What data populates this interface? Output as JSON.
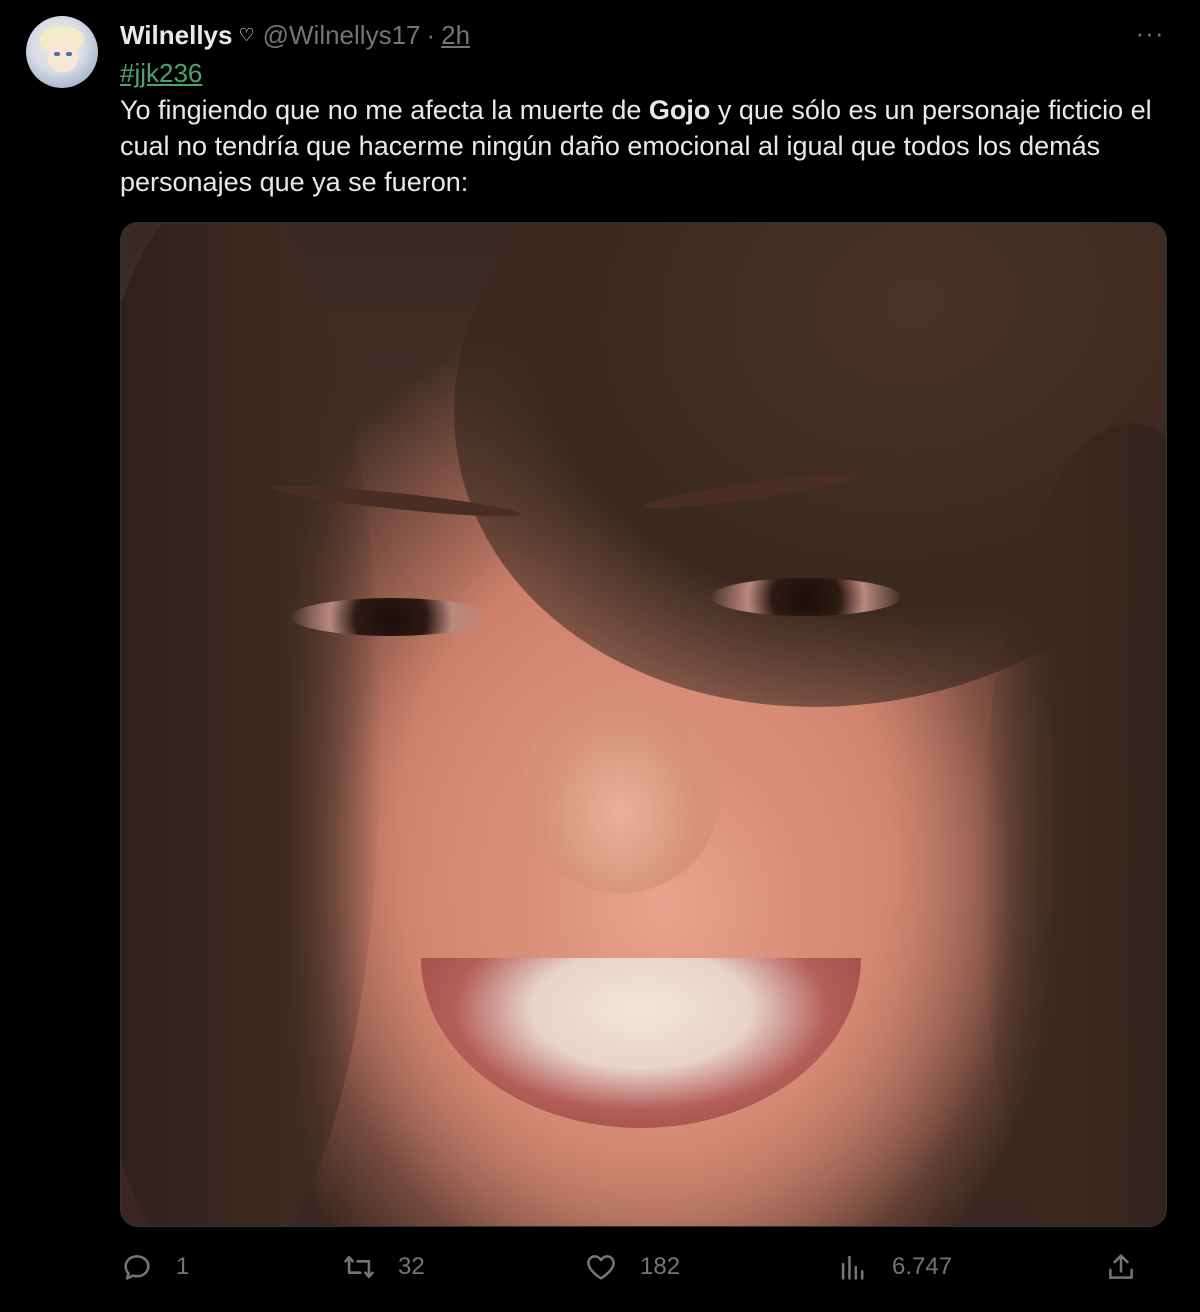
{
  "author": {
    "display_name": "Wilnellys",
    "badge_icon": "heart-outline-icon",
    "handle": "@Wilnellys17",
    "separator": "·",
    "time": "2h"
  },
  "menu": {
    "more_label": "···"
  },
  "tweet": {
    "hashtag": "#jjk236",
    "text_before": "Yo fingiendo que no me afecta la muerte de ",
    "text_bold": "Gojo",
    "text_after": " y que sólo es un personaje ficticio el cual no tendría que hacerme ningún daño emocional al igual que todos los demás personajes que ya se fueron:"
  },
  "actions": {
    "replies": "1",
    "retweets": "32",
    "likes": "182",
    "views": "6.747"
  },
  "colors": {
    "background": "#000000",
    "text": "#e7e9ea",
    "muted": "#71767b",
    "hashtag": "#4ba36e"
  }
}
